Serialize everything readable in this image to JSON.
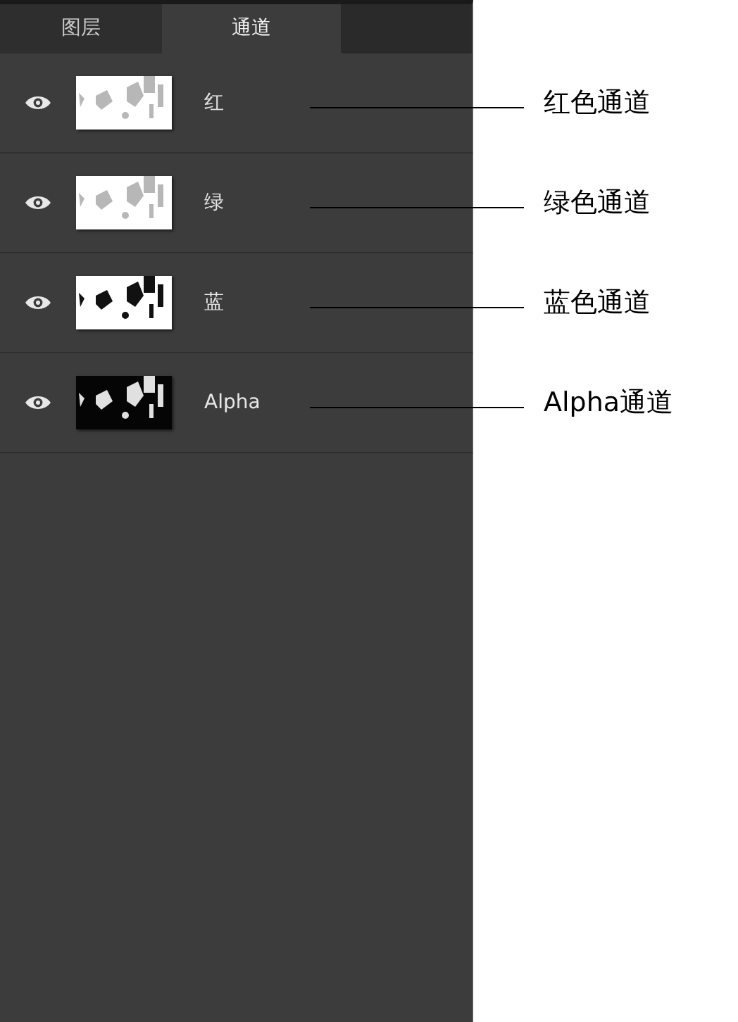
{
  "tabs": [
    {
      "label": "图层",
      "selected": false
    },
    {
      "label": "通道",
      "selected": true
    }
  ],
  "channels": [
    {
      "name": "红",
      "visible": true,
      "kind": "light",
      "annotation": "红色通道"
    },
    {
      "name": "绿",
      "visible": true,
      "kind": "light",
      "annotation": "绿色通道"
    },
    {
      "name": "蓝",
      "visible": true,
      "kind": "contrast",
      "annotation": "蓝色通道"
    },
    {
      "name": "Alpha",
      "visible": true,
      "kind": "dark",
      "annotation": "Alpha通道"
    }
  ]
}
